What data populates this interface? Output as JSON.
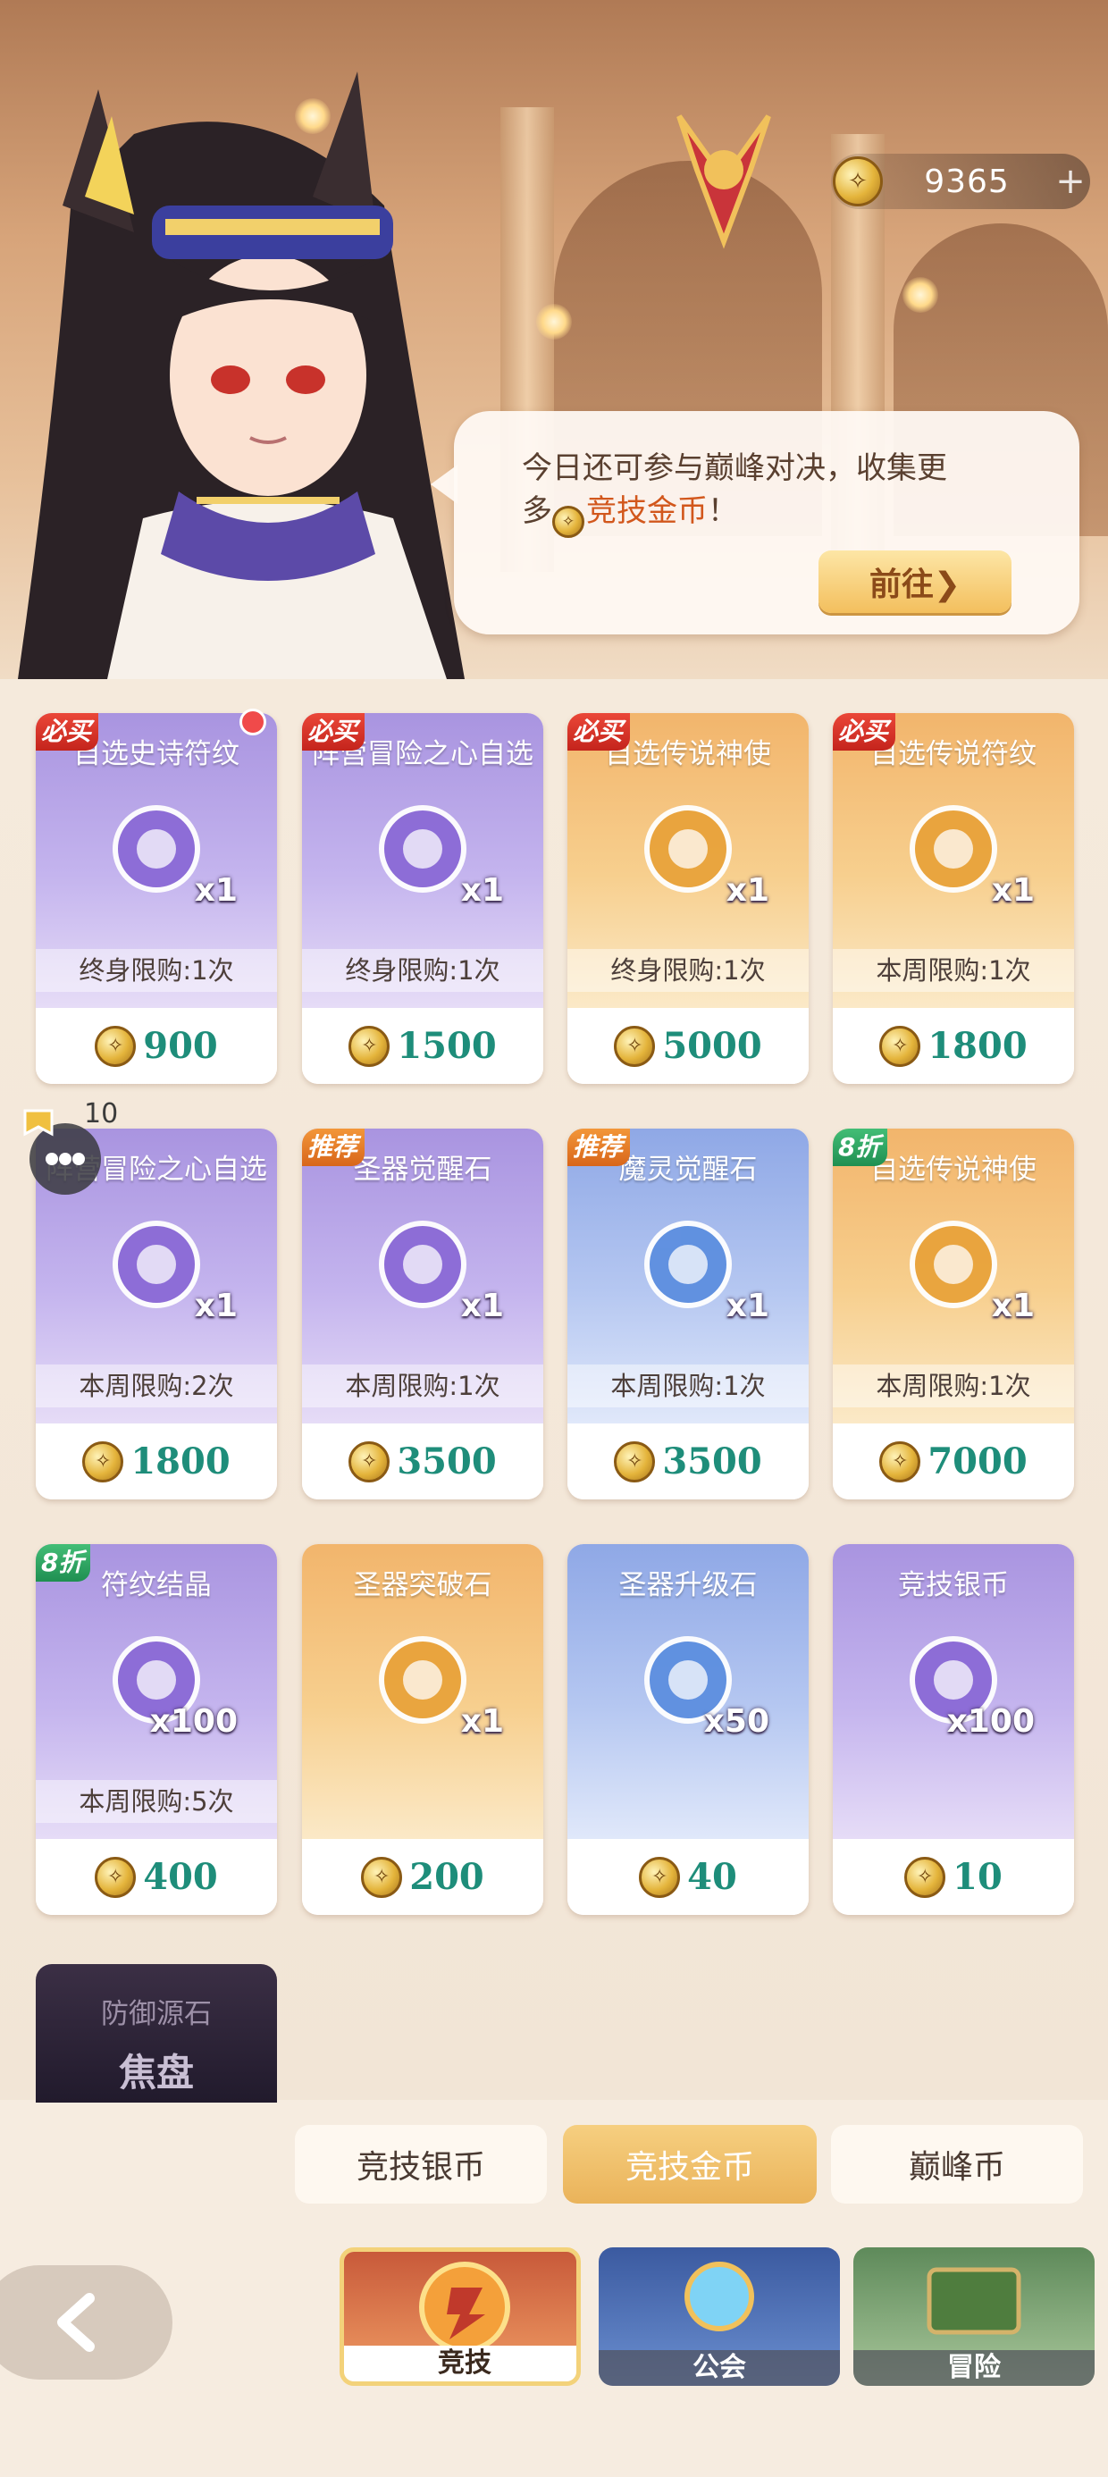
{
  "header": {
    "balance": "9365",
    "plus_icon": "plus-icon",
    "currency_icon": "arena-coin-icon"
  },
  "bubble": {
    "line1": "今日还可参与巅峰对决，收集更",
    "line2_prefix": "多",
    "line2_highlight": "竞技金币",
    "line2_suffix": "！",
    "go_label": "前往❯"
  },
  "cards": [
    {
      "name": "自选史诗符纹",
      "qty": "x1",
      "limit": "终身限购:1次",
      "price": "900",
      "badge": "必买",
      "theme": "purple"
    },
    {
      "name": "阵营冒险之心自选",
      "qty": "x1",
      "limit": "终身限购:1次",
      "price": "1500",
      "badge": "必买",
      "theme": "purple"
    },
    {
      "name": "自选传说神使",
      "qty": "x1",
      "limit": "终身限购:1次",
      "price": "5000",
      "badge": "必买",
      "theme": "orange"
    },
    {
      "name": "自选传说符纹",
      "qty": "x1",
      "limit": "本周限购:1次",
      "price": "1800",
      "badge": "必买",
      "theme": "orange"
    },
    {
      "name": "阵营冒险之心自选",
      "qty": "x1",
      "limit": "本周限购:2次",
      "price": "1800",
      "badge": "",
      "theme": "purple"
    },
    {
      "name": "圣器觉醒石",
      "qty": "x1",
      "limit": "本周限购:1次",
      "price": "3500",
      "badge": "推荐",
      "theme": "purple"
    },
    {
      "name": "魔灵觉醒石",
      "qty": "x1",
      "limit": "本周限购:1次",
      "price": "3500",
      "badge": "推荐",
      "theme": "blue"
    },
    {
      "name": "自选传说神使",
      "qty": "x1",
      "limit": "本周限购:1次",
      "price": "7000",
      "badge": "8折",
      "theme": "orange"
    },
    {
      "name": "符纹结晶",
      "qty": "x100",
      "limit": "本周限购:5次",
      "price": "400",
      "badge": "8折",
      "theme": "purple"
    },
    {
      "name": "圣器突破石",
      "qty": "x1",
      "limit": "",
      "price": "200",
      "badge": "",
      "theme": "orange"
    },
    {
      "name": "圣器升级石",
      "qty": "x50",
      "limit": "",
      "price": "40",
      "badge": "",
      "theme": "blue"
    },
    {
      "name": "竞技银币",
      "qty": "x100",
      "limit": "",
      "price": "10",
      "badge": "",
      "theme": "purple"
    }
  ],
  "partial_card": {
    "name": "防御源石",
    "sub": "焦盘"
  },
  "chat": {
    "count": "10"
  },
  "currency_tabs": [
    "竞技银币",
    "竞技金币",
    "巅峰币"
  ],
  "nav_tabs": [
    "竞技",
    "公会",
    "冒险"
  ]
}
